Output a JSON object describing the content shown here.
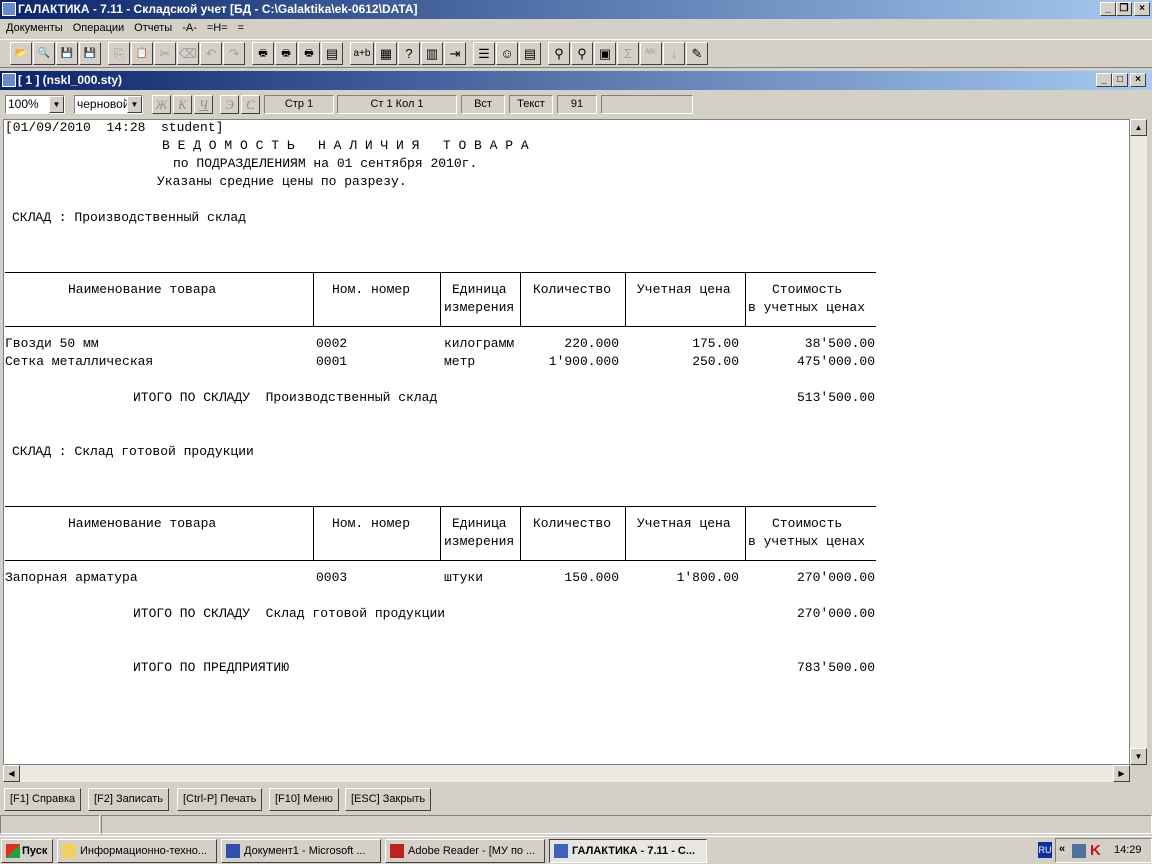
{
  "app": {
    "title": "ГАЛАКТИКА - 7.11 - Складской учет [БД - C:\\Galaktika\\ek-0612\\DATA]"
  },
  "menu": [
    "Документы",
    "Операции",
    "Отчеты",
    "-А-",
    "=Н=",
    "="
  ],
  "toolbar_icons": [
    "open-icon",
    "open-preview-icon",
    "save-icon",
    "save-as-icon",
    "copy-icon",
    "paste-icon",
    "cut-icon",
    "erase-icon",
    "undo-icon",
    "redo-icon",
    "print-icon",
    "print-check-icon",
    "print-setup-icon",
    "page-preview-icon",
    "concat-icon",
    "calculator-icon",
    "help-icon",
    "table-icon",
    "exit-icon",
    "list-icon",
    "smiley-icon",
    "form-icon",
    "find-icon",
    "find-next-icon",
    "properties-icon",
    "sum-icon",
    "spellcheck-icon",
    "sort-icon",
    "new-doc-icon"
  ],
  "child": {
    "title": "[ 1 ]   (nskl_000.sty)"
  },
  "doctoolbar": {
    "zoom": "100%",
    "mode": "черновой",
    "bold": "Ж",
    "italic": "К",
    "underline": "Ч",
    "e": "Э",
    "c": "С",
    "page": "Стр 1",
    "pos": "Ст 1  Кол 1",
    "insert": "Вст",
    "textmode": "Текст",
    "num": "91",
    "empty": ""
  },
  "report": {
    "header_line": "[01/09/2010  14:28  student]",
    "title": "В Е Д О М О С Т Ь   Н А Л И Ч И Я   Т О В А Р А",
    "subtitle": "по ПОДРАЗДЕЛЕНИЯМ на 01 сентября 2010г.",
    "note": "Указаны средние цены по разрезу.",
    "columns": {
      "name": "Наименование товара",
      "num": "Ном. номер",
      "unit1": "Единица",
      "unit2": "измерения",
      "qty": "Количество",
      "price": "Учетная цена",
      "cost1": "Стоимость",
      "cost2": "в учетных ценах"
    },
    "warehouses": [
      {
        "label": "СКЛАД : Производственный склад",
        "rows": [
          {
            "name": "Гвозди 50 мм",
            "num": "0002",
            "unit": "килограмм",
            "qty": "220.000",
            "price": "175.00",
            "cost": "38'500.00"
          },
          {
            "name": "Сетка металлическая",
            "num": "0001",
            "unit": "метр",
            "qty": "1'900.000",
            "price": "250.00",
            "cost": "475'000.00"
          }
        ],
        "total_label": "ИТОГО ПО СКЛАДУ  Производственный склад",
        "total": "513'500.00"
      },
      {
        "label": "СКЛАД : Склад готовой продукции",
        "rows": [
          {
            "name": "Запорная арматура",
            "num": "0003",
            "unit": "штуки",
            "qty": "150.000",
            "price": "1'800.00",
            "cost": "270'000.00"
          }
        ],
        "total_label": "ИТОГО ПО СКЛАДУ  Склад готовой продукции",
        "total": "270'000.00"
      }
    ],
    "grand_total_label": "ИТОГО ПО ПРЕДПРИЯТИЮ",
    "grand_total": "783'500.00"
  },
  "fkeys": [
    "[F1] Справка",
    "[F2] Записать",
    "[Ctrl-P] Печать",
    "[F10] Меню",
    "[ESC] Закрыть"
  ],
  "taskbar": {
    "start": "Пуск",
    "tasks": [
      "Информационно-техно...",
      "Документ1 - Microsoft ...",
      "Adobe Reader - [МУ по ...",
      "ГАЛАКТИКА - 7.11 - С..."
    ],
    "lang": "RU",
    "tray_arrow": "«",
    "clock": "14:29"
  }
}
